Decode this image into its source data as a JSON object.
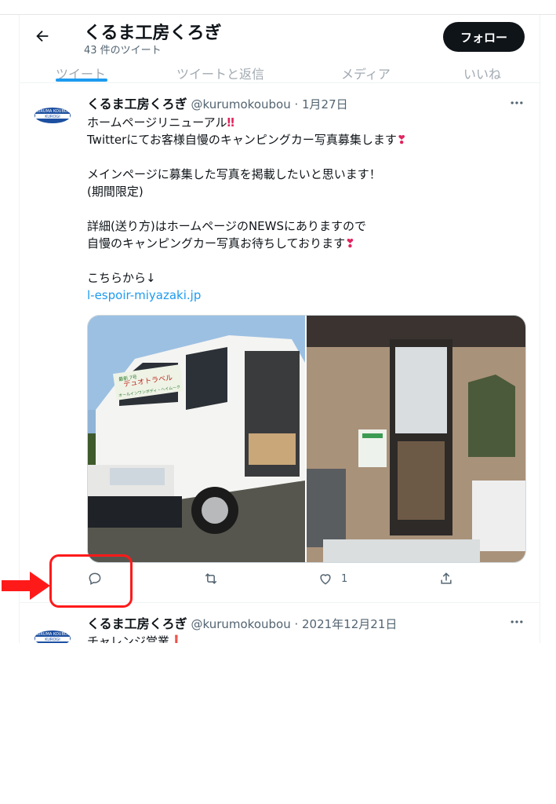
{
  "header": {
    "title": "くるま工房くろぎ",
    "subtitle": "43 件のツイート",
    "follow_label": "フォロー",
    "tabs": [
      "ツイート",
      "ツイートと返信",
      "メディア",
      "いいね"
    ]
  },
  "tweets": [
    {
      "name": "くるま工房くろぎ",
      "meta": "@kurumokoubou · 1月27日",
      "lines": [
        "ホームページリニューアル",
        "Twitterにてお客様自慢のキャンピングカー写真募集します",
        "",
        "メインページに募集した写真を掲載したいと思います！",
        "(期間限定)",
        "",
        "詳細(送り方)はホームページのNEWSにありますので",
        "自慢のキャンピングカー写真お待ちしております",
        "",
        "こちらから↓"
      ],
      "link": "l-espoir-miyazaki.jp",
      "emoji_double": "‼",
      "emoji_heart": "❣",
      "van_sign_top": "デュオトラベル",
      "van_sign_brand": "最新 7号",
      "van_sign_bottom": "オールインワンボディ・ヘイムーク",
      "like_count": "1"
    },
    {
      "name": "くるま工房くろぎ",
      "meta": "@kurumokoubou · 2021年12月21日",
      "line1": "チャレンジ営業",
      "emoji_mark": "❗"
    }
  ],
  "avatar_text": {
    "line1": "KURUMA KOUBOU",
    "line2": "KUROGI"
  },
  "colors": {
    "accent": "#1d9bf0",
    "highlight": "#ff1a1a",
    "text": "#0f1419",
    "muted": "#536471"
  }
}
